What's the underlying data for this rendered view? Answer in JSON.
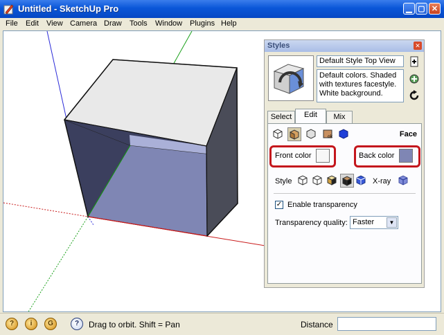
{
  "window": {
    "title": "Untitled - SketchUp Pro"
  },
  "menu": [
    "File",
    "Edit",
    "View",
    "Camera",
    "Draw",
    "Tools",
    "Window",
    "Plugins",
    "Help"
  ],
  "styles_panel": {
    "title": "Styles",
    "style_name": "Default Style Top View",
    "description": "Default colors.  Shaded with textures facestyle.  White background.",
    "tabs": [
      "Select",
      "Edit",
      "Mix"
    ],
    "active_tab": "Edit",
    "section_label": "Face",
    "front_color_label": "Front color",
    "front_color": "#f7f7f7",
    "back_color_label": "Back color",
    "back_color": "#7f86b4",
    "style_label": "Style",
    "xray_label": "X-ray",
    "enable_transparency_label": "Enable transparency",
    "enable_transparency_checked": true,
    "transparency_quality_label": "Transparency quality:",
    "transparency_quality_value": "Faster"
  },
  "statusbar": {
    "hint": "Drag to orbit.  Shift = Pan",
    "distance_label": "Distance",
    "distance_value": ""
  },
  "icons": [
    "sketchup-app-icon",
    "minimize-icon",
    "maximize-icon",
    "close-icon",
    "geolocation-icon",
    "credits-icon",
    "google-icon",
    "help-icon"
  ]
}
